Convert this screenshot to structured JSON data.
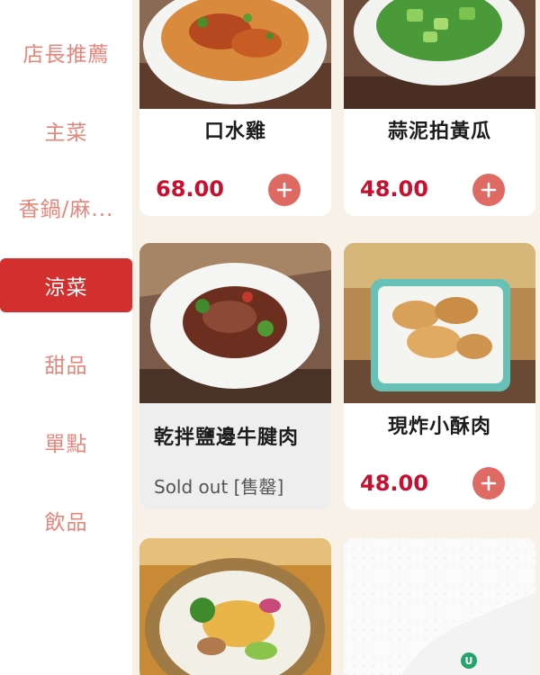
{
  "categories": [
    {
      "label": "店長推薦",
      "active": false
    },
    {
      "label": "主菜",
      "active": false
    },
    {
      "label": "香鍋/麻...",
      "active": false
    },
    {
      "label": "涼菜",
      "active": true
    },
    {
      "label": "甜品",
      "active": false
    },
    {
      "label": "單點",
      "active": false
    },
    {
      "label": "飲品",
      "active": false
    }
  ],
  "items": [
    {
      "name": "口水雞",
      "price": "68.00",
      "status": "available",
      "image_icon": "chili-chicken-dish"
    },
    {
      "name": "蒜泥拍黃瓜",
      "price": "48.00",
      "status": "available",
      "image_icon": "cucumber-salad-dish"
    },
    {
      "name": "乾拌鹽邊牛腱肉",
      "status_text": "Sold out [售罄]",
      "status": "sold-out",
      "image_icon": "beef-shank-dish"
    },
    {
      "name": "現炸小酥肉",
      "price": "48.00",
      "status": "available",
      "image_icon": "fried-pork-dish"
    },
    {
      "name": "",
      "status": "partial",
      "image_icon": "noodle-salad-dish"
    },
    {
      "name": "",
      "status": "placeholder",
      "image_icon": "placeholder-pattern"
    }
  ],
  "fab": {
    "label": "U"
  },
  "colors": {
    "accent": "#d32f2f",
    "price": "#c8102e",
    "add_button": "#df6a63",
    "category_text": "#e8857b",
    "background": "#f7f1e8"
  }
}
